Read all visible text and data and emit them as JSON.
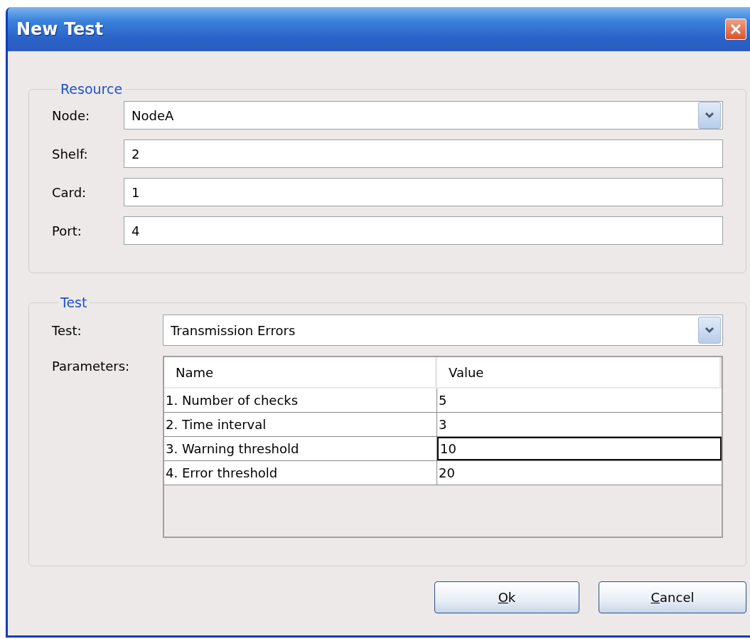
{
  "window": {
    "title": "New Test"
  },
  "resource": {
    "title": "Resource",
    "fields": [
      {
        "kind": "dropdown",
        "label": "Node:",
        "value": "NodeA"
      },
      {
        "kind": "text",
        "label": "Shelf:",
        "value": "2"
      },
      {
        "kind": "text",
        "label": "Card:",
        "value": "1"
      },
      {
        "kind": "text",
        "label": "Port:",
        "value": "4"
      }
    ]
  },
  "test": {
    "title": "Test",
    "test_label": "Test:",
    "test_value": "Transmission Errors",
    "parameters_label": "Parameters:",
    "table": {
      "columns": [
        "Name",
        "Value"
      ],
      "rows": [
        {
          "name": "1. Number of checks",
          "value": "5",
          "selected": false
        },
        {
          "name": "2. Time interval",
          "value": "3",
          "selected": false
        },
        {
          "name": "3. Warning threshold",
          "value": "10",
          "selected": true
        },
        {
          "name": "4. Error threshold",
          "value": "20",
          "selected": false
        }
      ]
    }
  },
  "buttons": [
    {
      "label": "Ok",
      "access_key_underlined": true
    },
    {
      "label": "Cancel",
      "access_key_underlined": true
    }
  ]
}
